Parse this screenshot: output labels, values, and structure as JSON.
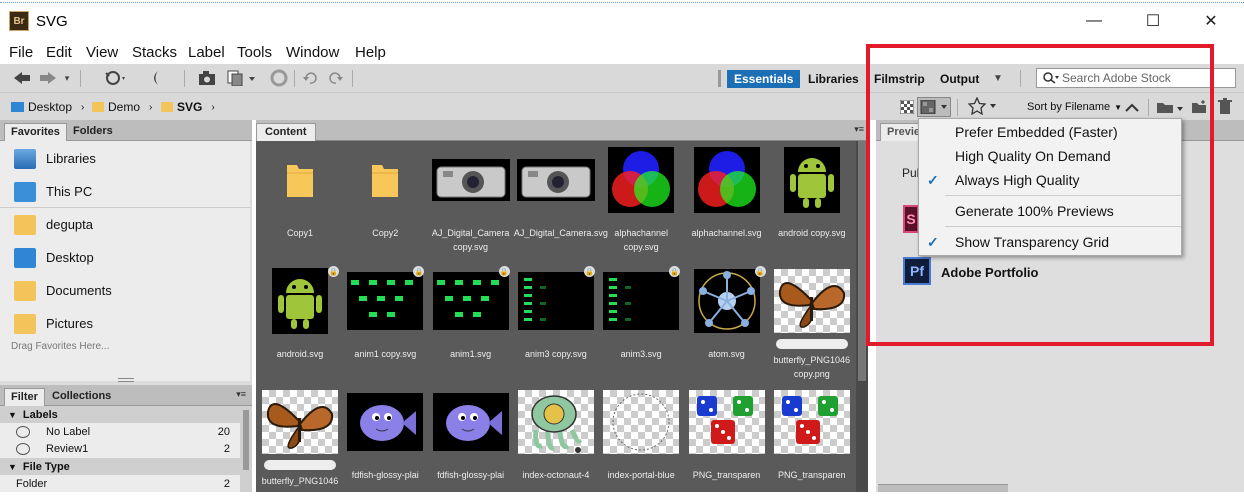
{
  "window": {
    "app_badge": "Br",
    "title": "SVG",
    "minimize": "—",
    "maximize": "☐",
    "close": "✕"
  },
  "menu": [
    "File",
    "Edit",
    "View",
    "Stacks",
    "Label",
    "Tools",
    "Window",
    "Help"
  ],
  "workspaces": {
    "essentials": "Essentials",
    "libraries": "Libraries",
    "filmstrip": "Filmstrip",
    "output": "Output"
  },
  "search": {
    "placeholder": "Search Adobe Stock"
  },
  "breadcrumb": [
    "Desktop",
    "Demo",
    "SVG"
  ],
  "sort": {
    "label": "Sort by Filename"
  },
  "left_panel": {
    "tabs": [
      "Favorites",
      "Folders"
    ],
    "favorites": [
      "Libraries",
      "This PC",
      "degupta",
      "Desktop",
      "Documents",
      "Pictures"
    ],
    "drag_hint": "Drag Favorites Here...",
    "filter_tabs": [
      "Filter",
      "Collections"
    ],
    "filter": {
      "labels_heading": "Labels",
      "rows": [
        {
          "label": "No Label",
          "count": "20"
        },
        {
          "label": "Review1",
          "count": "2"
        }
      ],
      "file_type_heading": "File Type",
      "file_type_rows": [
        {
          "label": "Folder",
          "count": "2"
        }
      ]
    }
  },
  "content": {
    "tab": "Content",
    "items": [
      {
        "name": "Copy1",
        "kind": "folder"
      },
      {
        "name": "Copy2",
        "kind": "folder"
      },
      {
        "name": "AJ_Digital_Camera copy.svg",
        "kind": "camera"
      },
      {
        "name": "AJ_Digital_Camera.svg",
        "kind": "camera"
      },
      {
        "name": "alphachannel copy.svg",
        "kind": "rgb"
      },
      {
        "name": "alphachannel.svg",
        "kind": "rgb"
      },
      {
        "name": "android copy.svg",
        "kind": "android"
      },
      {
        "name": "android.svg",
        "kind": "android"
      },
      {
        "name": "anim1 copy.svg",
        "kind": "anim"
      },
      {
        "name": "anim1.svg",
        "kind": "anim"
      },
      {
        "name": "anim3 copy.svg",
        "kind": "anim3"
      },
      {
        "name": "anim3.svg",
        "kind": "anim3"
      },
      {
        "name": "atom.svg",
        "kind": "atom"
      },
      {
        "name": "butterfly_PNG1046 copy.png",
        "kind": "butterfly"
      },
      {
        "name": "butterfly_PNG1046",
        "kind": "butterfly"
      },
      {
        "name": "fdfish-glossy-plai",
        "kind": "fish"
      },
      {
        "name": "fdfish-glossy-plai",
        "kind": "fish"
      },
      {
        "name": "index-octonaut-4",
        "kind": "octo"
      },
      {
        "name": "index-portal-blue",
        "kind": "portal"
      },
      {
        "name": "PNG_transparen",
        "kind": "dice"
      },
      {
        "name": "PNG_transparen",
        "kind": "dice"
      }
    ]
  },
  "right_panel": {
    "tab": "Previe",
    "pub_label": "Pul",
    "portfolio": "Adobe Portfolio",
    "portfolio_badge": "Pf",
    "stock_badge": "S"
  },
  "dropdown": {
    "items": [
      {
        "label": "Prefer Embedded (Faster)",
        "checked": false
      },
      {
        "label": "High Quality On Demand",
        "checked": false
      },
      {
        "label": "Always High Quality",
        "checked": true
      },
      {
        "label": "Generate 100% Previews",
        "checked": false
      },
      {
        "label": "Show Transparency Grid",
        "checked": true
      }
    ]
  },
  "colors": {
    "accent": "#1c6fb5",
    "highlight": "#e21b2a",
    "content_bg": "#5a5a5a"
  }
}
